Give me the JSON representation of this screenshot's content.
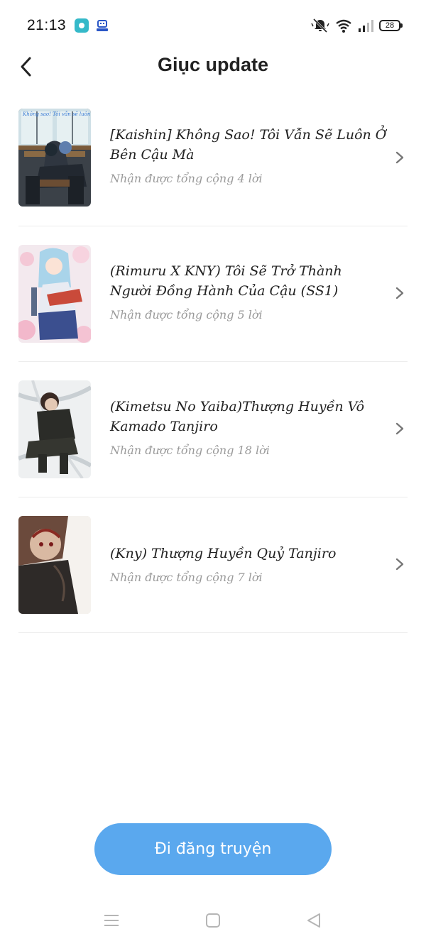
{
  "status_bar": {
    "time": "21:13",
    "battery": "28"
  },
  "header": {
    "title": "Giục update"
  },
  "items": [
    {
      "title": "[Kaishin] Không Sao! Tôi Vẫn Sẽ Luôn Ở Bên Cậu Mà",
      "subtitle": "Nhận được tổng cộng 4 lời",
      "cover_text": "Không sao! Tôi vẫn sẽ luôn ở bên cậu mà"
    },
    {
      "title": "(Rimuru X KNY) Tôi Sẽ Trở Thành Người Đồng Hành Của Cậu (SS1)",
      "subtitle": "Nhận được tổng cộng 5 lời"
    },
    {
      "title": "(Kimetsu No Yaiba)Thượng Huyền Vô Kamado Tanjiro",
      "subtitle": "Nhận được tổng cộng 18 lời"
    },
    {
      "title": "(Kny) Thượng Huyền Quỷ Tanjiro",
      "subtitle": "Nhận được tổng cộng 7 lời"
    }
  ],
  "footer": {
    "button_label": "Đi đăng truyện"
  },
  "colors": {
    "accent": "#5aa8ee",
    "divider": "#ececec",
    "subtitle": "#9a9a9a"
  },
  "icons": [
    "back-arrow-icon",
    "chevron-right-icon",
    "menu-icon",
    "home-icon",
    "back-triangle-icon",
    "mute-icon",
    "wifi-icon",
    "signal-icon",
    "battery-icon"
  ]
}
